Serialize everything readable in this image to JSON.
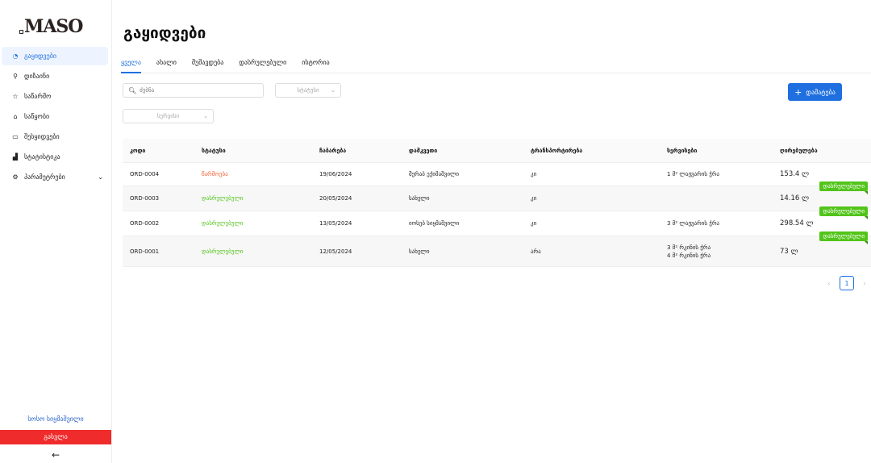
{
  "brand": {
    "logo_text": "MASO"
  },
  "sidebar": {
    "items": [
      {
        "label": "გაყიდვები",
        "icon": "◔",
        "active": true
      },
      {
        "label": "დიზაინი",
        "icon": "⚲"
      },
      {
        "label": "საწარმო",
        "icon": "☆"
      },
      {
        "label": "საწყობი",
        "icon": "⌂"
      },
      {
        "label": "შესყიდვები",
        "icon": "▭"
      },
      {
        "label": "სტატისტიკა",
        "icon": "▟"
      },
      {
        "label": "პარამეტრები",
        "icon": "⚙",
        "chevron": "⌄"
      }
    ],
    "user_name": "სოსო სიყმაშვილი",
    "logout_label": "გასვლა",
    "collapse_icon": "←"
  },
  "page": {
    "title": "გაყიდვები"
  },
  "tabs": [
    {
      "label": "ყველა",
      "active": true
    },
    {
      "label": "ახალი"
    },
    {
      "label": "მუშავდება"
    },
    {
      "label": "დასრულებული"
    },
    {
      "label": "ისტორია"
    }
  ],
  "filters": {
    "search_placeholder": "ძებნა",
    "status_placeholder": "სტატუსი",
    "services_placeholder": "სერვისი"
  },
  "add_button": {
    "label": "დამატება",
    "icon": "+"
  },
  "table": {
    "headers": [
      "კოდი",
      "სტატუსი",
      "ჩაბარება",
      "დამკვეთი",
      "ტრანსპორტირება",
      "სერვისები",
      "ღირებულება"
    ],
    "rows": [
      {
        "code": "ORD-0004",
        "status": "წარმოება",
        "status_type": "pending",
        "date": "19/06/2024",
        "customer": "შერაბ ექიმაშვილი",
        "transport": "კი",
        "services": [
          "1 მ² ლაჟვარის ჭრა"
        ],
        "price": "153.4 ლ",
        "ribbon": ""
      },
      {
        "code": "ORD-0003",
        "status": "დასრულებული",
        "status_type": "done",
        "date": "20/05/2024",
        "customer": "სახელი",
        "transport": "კი",
        "services": [
          ""
        ],
        "price": "14.16 ლ",
        "ribbon": "დასრულებული"
      },
      {
        "code": "ORD-0002",
        "status": "დასრულებული",
        "status_type": "done",
        "date": "13/05/2024",
        "customer": "იოსებ სიყმაშვილი",
        "transport": "კი",
        "services": [
          "3 მ² ლაჟვარის ჭრა"
        ],
        "price": "298.54 ლ",
        "ribbon": "დასრულებული"
      },
      {
        "code": "ORD-0001",
        "status": "დასრულებული",
        "status_type": "done",
        "date": "12/05/2024",
        "customer": "სახელი",
        "transport": "არა",
        "services": [
          "3 მ² რკინის ჭრა",
          "4 მ² რკინის ჭრა"
        ],
        "price": "73 ლ",
        "ribbon": "დასრულებული"
      }
    ]
  },
  "pagination": {
    "current": "1",
    "prev_icon": "‹",
    "next_icon": "›"
  }
}
